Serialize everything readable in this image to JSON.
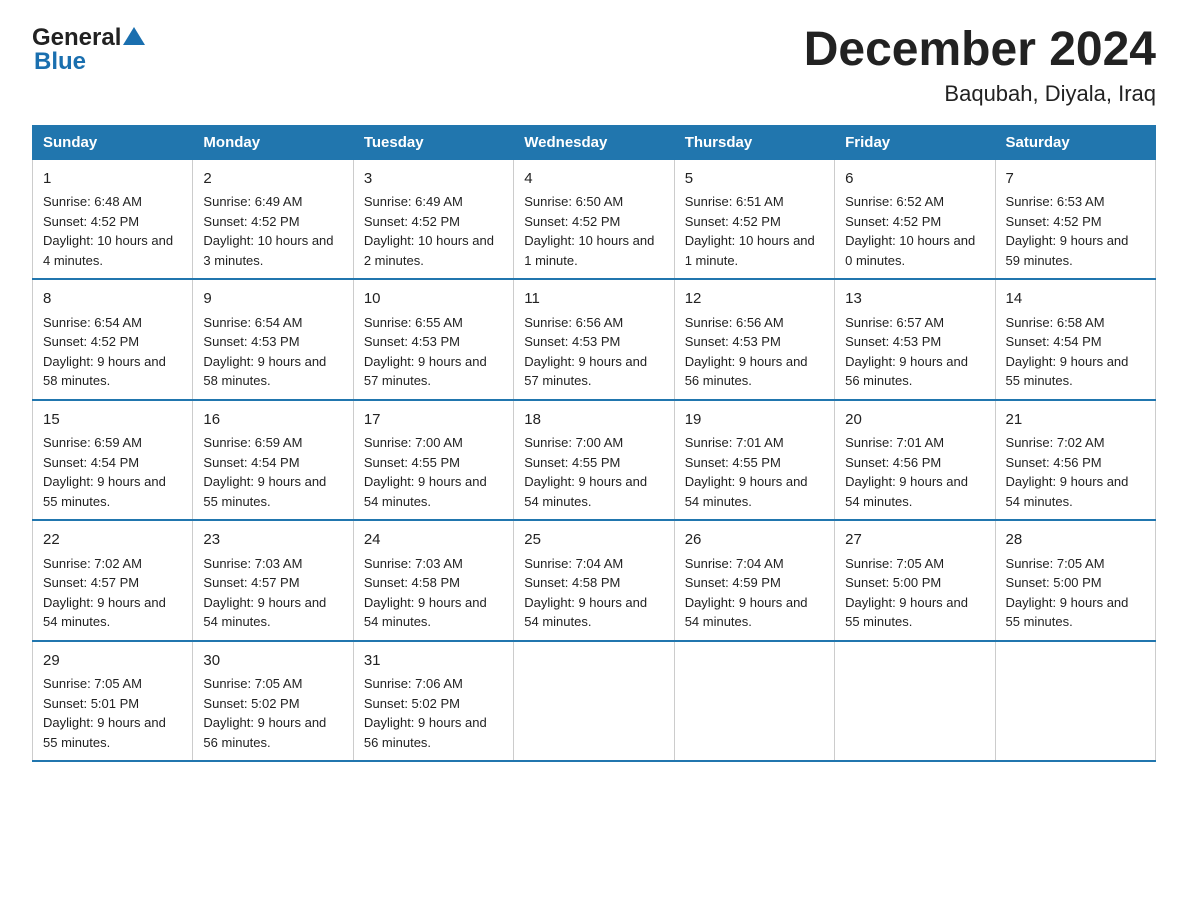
{
  "header": {
    "logo_general": "General",
    "logo_blue": "Blue",
    "title": "December 2024",
    "subtitle": "Baqubah, Diyala, Iraq"
  },
  "weekdays": [
    "Sunday",
    "Monday",
    "Tuesday",
    "Wednesday",
    "Thursday",
    "Friday",
    "Saturday"
  ],
  "weeks": [
    [
      {
        "date": "1",
        "sunrise": "6:48 AM",
        "sunset": "4:52 PM",
        "daylight": "10 hours and 4 minutes."
      },
      {
        "date": "2",
        "sunrise": "6:49 AM",
        "sunset": "4:52 PM",
        "daylight": "10 hours and 3 minutes."
      },
      {
        "date": "3",
        "sunrise": "6:49 AM",
        "sunset": "4:52 PM",
        "daylight": "10 hours and 2 minutes."
      },
      {
        "date": "4",
        "sunrise": "6:50 AM",
        "sunset": "4:52 PM",
        "daylight": "10 hours and 1 minute."
      },
      {
        "date": "5",
        "sunrise": "6:51 AM",
        "sunset": "4:52 PM",
        "daylight": "10 hours and 1 minute."
      },
      {
        "date": "6",
        "sunrise": "6:52 AM",
        "sunset": "4:52 PM",
        "daylight": "10 hours and 0 minutes."
      },
      {
        "date": "7",
        "sunrise": "6:53 AM",
        "sunset": "4:52 PM",
        "daylight": "9 hours and 59 minutes."
      }
    ],
    [
      {
        "date": "8",
        "sunrise": "6:54 AM",
        "sunset": "4:52 PM",
        "daylight": "9 hours and 58 minutes."
      },
      {
        "date": "9",
        "sunrise": "6:54 AM",
        "sunset": "4:53 PM",
        "daylight": "9 hours and 58 minutes."
      },
      {
        "date": "10",
        "sunrise": "6:55 AM",
        "sunset": "4:53 PM",
        "daylight": "9 hours and 57 minutes."
      },
      {
        "date": "11",
        "sunrise": "6:56 AM",
        "sunset": "4:53 PM",
        "daylight": "9 hours and 57 minutes."
      },
      {
        "date": "12",
        "sunrise": "6:56 AM",
        "sunset": "4:53 PM",
        "daylight": "9 hours and 56 minutes."
      },
      {
        "date": "13",
        "sunrise": "6:57 AM",
        "sunset": "4:53 PM",
        "daylight": "9 hours and 56 minutes."
      },
      {
        "date": "14",
        "sunrise": "6:58 AM",
        "sunset": "4:54 PM",
        "daylight": "9 hours and 55 minutes."
      }
    ],
    [
      {
        "date": "15",
        "sunrise": "6:59 AM",
        "sunset": "4:54 PM",
        "daylight": "9 hours and 55 minutes."
      },
      {
        "date": "16",
        "sunrise": "6:59 AM",
        "sunset": "4:54 PM",
        "daylight": "9 hours and 55 minutes."
      },
      {
        "date": "17",
        "sunrise": "7:00 AM",
        "sunset": "4:55 PM",
        "daylight": "9 hours and 54 minutes."
      },
      {
        "date": "18",
        "sunrise": "7:00 AM",
        "sunset": "4:55 PM",
        "daylight": "9 hours and 54 minutes."
      },
      {
        "date": "19",
        "sunrise": "7:01 AM",
        "sunset": "4:55 PM",
        "daylight": "9 hours and 54 minutes."
      },
      {
        "date": "20",
        "sunrise": "7:01 AM",
        "sunset": "4:56 PM",
        "daylight": "9 hours and 54 minutes."
      },
      {
        "date": "21",
        "sunrise": "7:02 AM",
        "sunset": "4:56 PM",
        "daylight": "9 hours and 54 minutes."
      }
    ],
    [
      {
        "date": "22",
        "sunrise": "7:02 AM",
        "sunset": "4:57 PM",
        "daylight": "9 hours and 54 minutes."
      },
      {
        "date": "23",
        "sunrise": "7:03 AM",
        "sunset": "4:57 PM",
        "daylight": "9 hours and 54 minutes."
      },
      {
        "date": "24",
        "sunrise": "7:03 AM",
        "sunset": "4:58 PM",
        "daylight": "9 hours and 54 minutes."
      },
      {
        "date": "25",
        "sunrise": "7:04 AM",
        "sunset": "4:58 PM",
        "daylight": "9 hours and 54 minutes."
      },
      {
        "date": "26",
        "sunrise": "7:04 AM",
        "sunset": "4:59 PM",
        "daylight": "9 hours and 54 minutes."
      },
      {
        "date": "27",
        "sunrise": "7:05 AM",
        "sunset": "5:00 PM",
        "daylight": "9 hours and 55 minutes."
      },
      {
        "date": "28",
        "sunrise": "7:05 AM",
        "sunset": "5:00 PM",
        "daylight": "9 hours and 55 minutes."
      }
    ],
    [
      {
        "date": "29",
        "sunrise": "7:05 AM",
        "sunset": "5:01 PM",
        "daylight": "9 hours and 55 minutes."
      },
      {
        "date": "30",
        "sunrise": "7:05 AM",
        "sunset": "5:02 PM",
        "daylight": "9 hours and 56 minutes."
      },
      {
        "date": "31",
        "sunrise": "7:06 AM",
        "sunset": "5:02 PM",
        "daylight": "9 hours and 56 minutes."
      },
      null,
      null,
      null,
      null
    ]
  ]
}
